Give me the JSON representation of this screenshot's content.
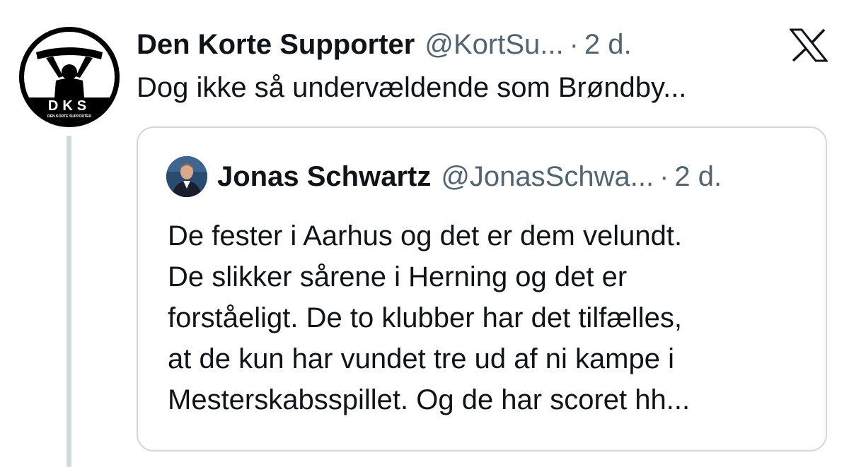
{
  "tweet": {
    "author_name": "Den Korte Supporter",
    "author_handle": "@KortSu...",
    "separator": "·",
    "time": "2 d.",
    "avatar_icon": "dks-logo-icon",
    "avatar_logo_text": "DKS",
    "avatar_logo_subtext": "DEN KORTE SUPPORTER",
    "text": "Dog ikke så undervældende som Brøndby..."
  },
  "platform": {
    "logo_icon": "x-logo-icon"
  },
  "quote": {
    "author_name": "Jonas Schwartz",
    "author_handle": "@JonasSchwa...",
    "separator": "·",
    "time": "2 d.",
    "avatar_icon": "profile-photo-icon",
    "lines": [
      "De fester i Aarhus og det er dem velundt.",
      "De slikker sårene i Herning og det er",
      "forståeligt. De to klubber har det tilfælles,",
      "at de kun har vundet tre ud af ni kampe i",
      "Mesterskabsspillet. Og de har scoret hh..."
    ]
  },
  "colors": {
    "text_primary": "#0f1419",
    "text_secondary": "#536471",
    "border": "#cfd9de",
    "background": "#ffffff"
  }
}
